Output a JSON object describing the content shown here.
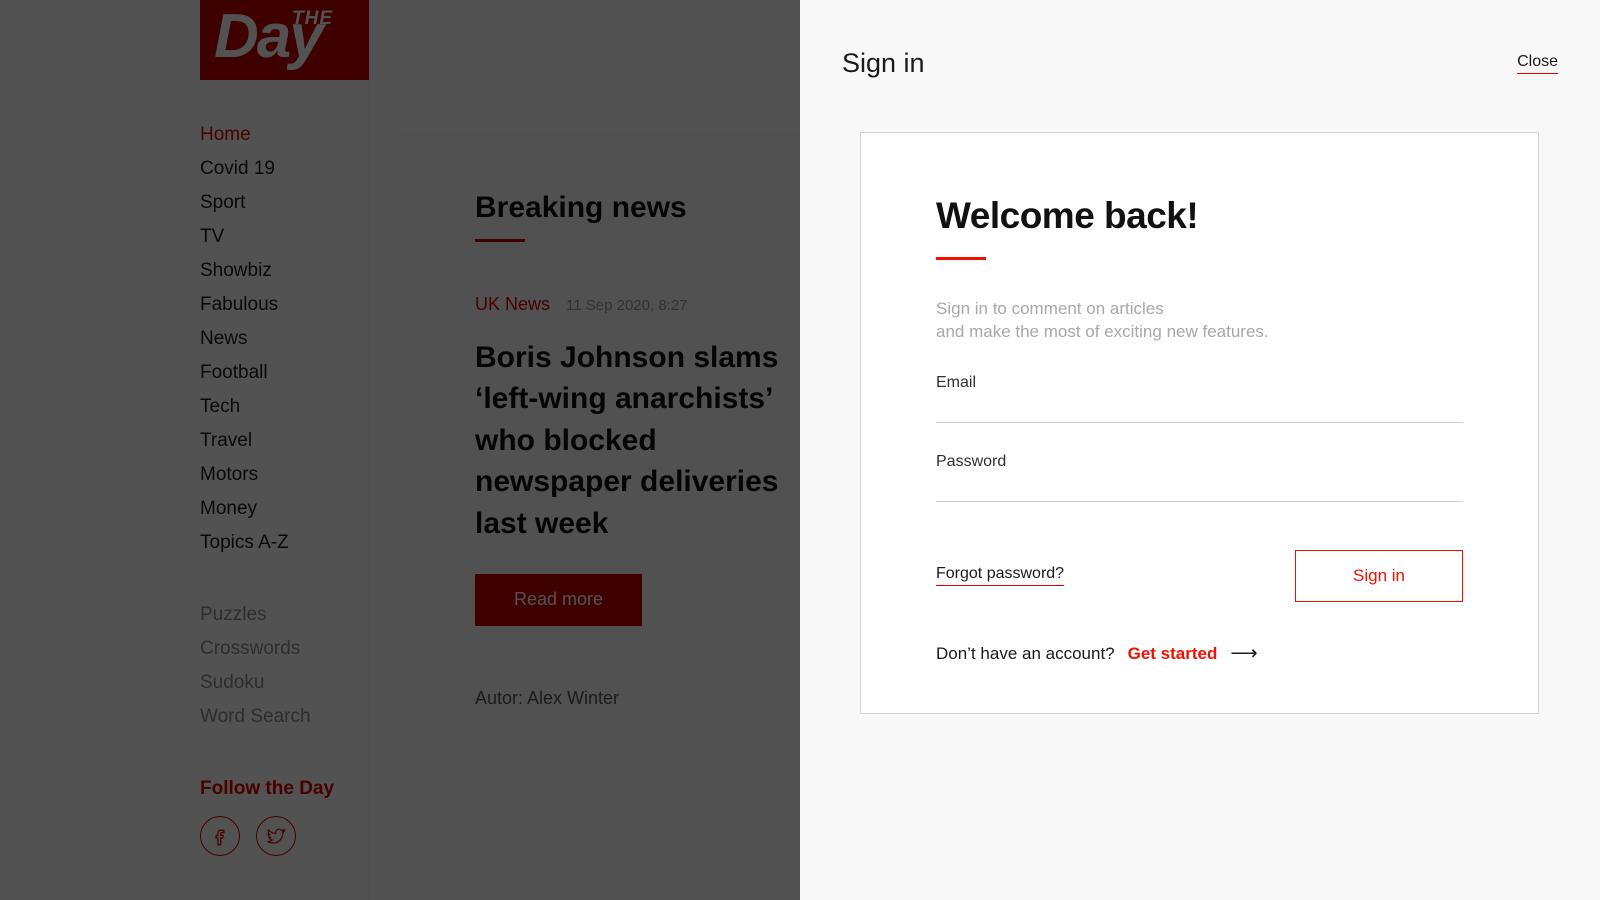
{
  "site": {
    "logo": {
      "top_word": "THE",
      "main_word": "Day"
    },
    "nav_primary": [
      {
        "label": "Home",
        "active": true
      },
      {
        "label": "Covid 19",
        "active": false
      },
      {
        "label": "Sport",
        "active": false
      },
      {
        "label": "TV",
        "active": false
      },
      {
        "label": "Showbiz",
        "active": false
      },
      {
        "label": "Fabulous",
        "active": false
      },
      {
        "label": "News",
        "active": false
      },
      {
        "label": "Football",
        "active": false
      },
      {
        "label": "Tech",
        "active": false
      },
      {
        "label": "Travel",
        "active": false
      },
      {
        "label": "Motors",
        "active": false
      },
      {
        "label": "Money",
        "active": false
      },
      {
        "label": "Topics A-Z",
        "active": false
      }
    ],
    "nav_secondary": [
      {
        "label": "Puzzles"
      },
      {
        "label": "Crosswords"
      },
      {
        "label": "Sudoku"
      },
      {
        "label": "Word Search"
      }
    ],
    "follow": {
      "title": "Follow the Day",
      "icons": [
        {
          "name": "facebook-icon"
        },
        {
          "name": "twitter-icon"
        }
      ]
    },
    "article": {
      "section_title": "Breaking news",
      "category": "UK News",
      "date": "11 Sep 2020, 8:27",
      "headline": "Boris Johnson slams ‘left-wing anarchists’ who blocked newspaper deliveries last week",
      "read_more_label": "Read more",
      "author": "Autor: Alex Winter"
    }
  },
  "signin_panel": {
    "title": "Sign in",
    "close_label": "Close",
    "heading": "Welcome back!",
    "subtitle_line1": "Sign in to comment on articles",
    "subtitle_line2": "and make the most of exciting new features.",
    "email": {
      "label": "Email",
      "value": "",
      "placeholder": ""
    },
    "password": {
      "label": "Password",
      "value": "",
      "placeholder": ""
    },
    "forgot_label": "Forgot password?",
    "submit_label": "Sign in",
    "signup_prompt": "Don’t have an account?",
    "signup_link": "Get started",
    "signup_arrow": "⟶"
  },
  "colors": {
    "brand_red": "#e00000",
    "accent_red": "#f01000",
    "logo_red": "#c30000",
    "overlay": "rgba(0,0,0,0.68)",
    "panel_bg": "#f8f8f8",
    "card_bg": "#ffffff"
  }
}
